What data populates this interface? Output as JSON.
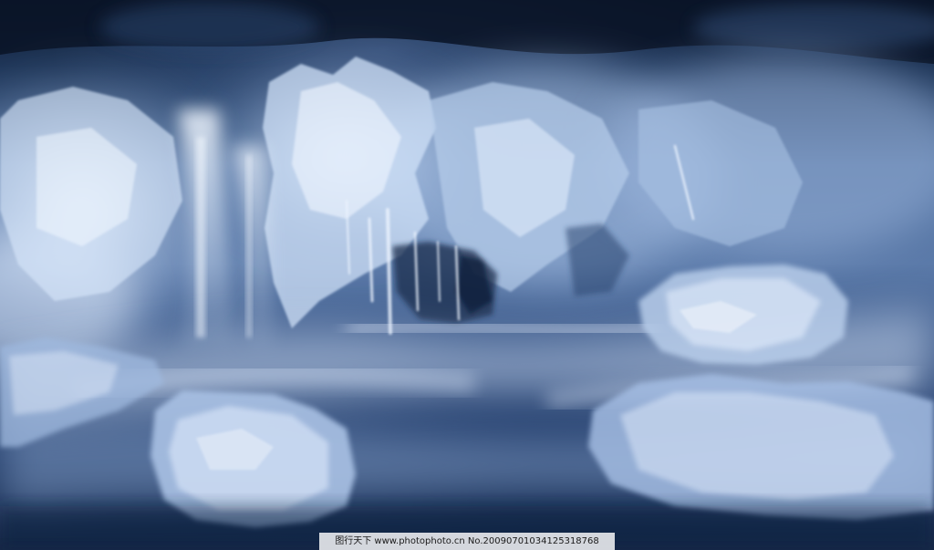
{
  "image": {
    "subject": "frozen-waterfall-ice",
    "palette": {
      "deep_blue": "#142848",
      "mid_blue": "#4f6f9d",
      "ice_highlight": "#e8f2ff",
      "mist": "#c9d8ef",
      "shadow": "#0b1526"
    }
  },
  "watermark": {
    "text": "图行天下 www.photophoto.cn No.20090701034125318768"
  }
}
